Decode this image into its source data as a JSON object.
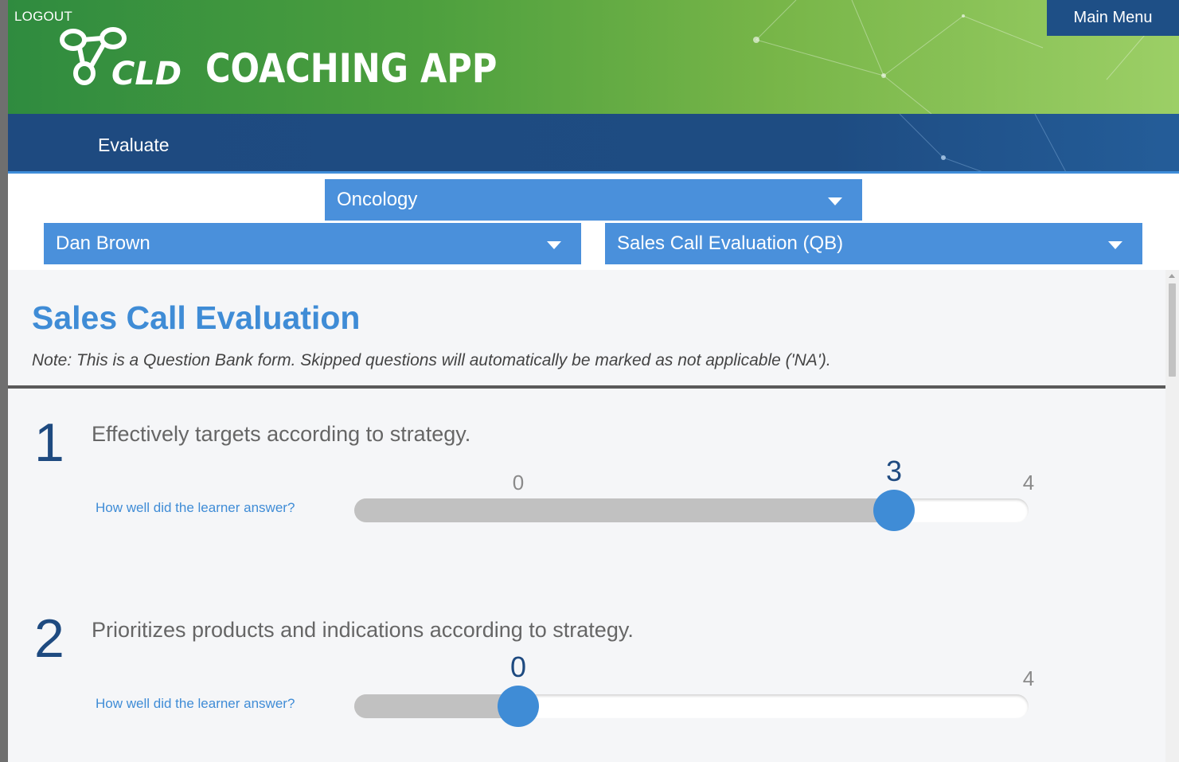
{
  "header": {
    "logout_label": "LOGOUT",
    "logo_text": "CLD",
    "app_title": "COACHING APP",
    "main_menu_label": "Main Menu"
  },
  "nav": {
    "active_label": "Evaluate"
  },
  "filters": {
    "therapeutic_area": "Oncology",
    "learner": "Dan Brown",
    "form": "Sales Call Evaluation (QB)"
  },
  "form": {
    "title": "Sales Call Evaluation",
    "note": "Note: This is a Question Bank form. Skipped questions will automatically be marked as not applicable ('NA')."
  },
  "questions": [
    {
      "number": "1",
      "text": "Effectively targets according to strategy.",
      "prompt": "How well did the learner answer?",
      "min_label": "0",
      "max_label": "4",
      "value": 3,
      "value_label": "3"
    },
    {
      "number": "2",
      "text": "Prioritizes products and indications according to strategy.",
      "prompt": "How well did the learner answer?",
      "min_label": "0",
      "max_label": "4",
      "value": 0,
      "value_label": "0"
    }
  ],
  "colors": {
    "brand_green": "#4c9f3e",
    "nav_blue": "#1e4a80",
    "accent_blue": "#3f8cd6",
    "select_blue": "#4a90db"
  }
}
